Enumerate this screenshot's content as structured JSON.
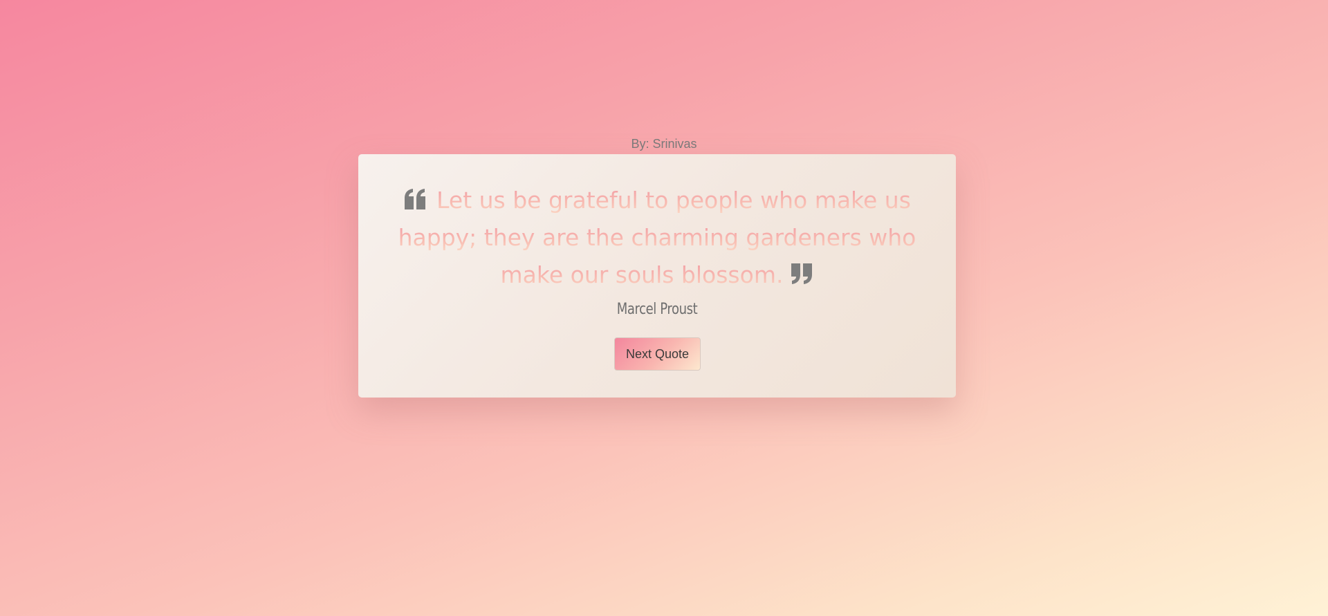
{
  "byline": "By: Srinivas",
  "quote": {
    "text": "Let us be grateful to people who make us happy; they are the charming gardeners who make our souls blossom.",
    "author": "Marcel Proust",
    "open_icon": "quote-left-icon",
    "close_icon": "quote-right-icon"
  },
  "actions": {
    "next_label": "Next Quote"
  },
  "colors": {
    "quote_mark": "#7d7d7d",
    "author": "#6e6e6e",
    "accent": "#f3869d"
  }
}
